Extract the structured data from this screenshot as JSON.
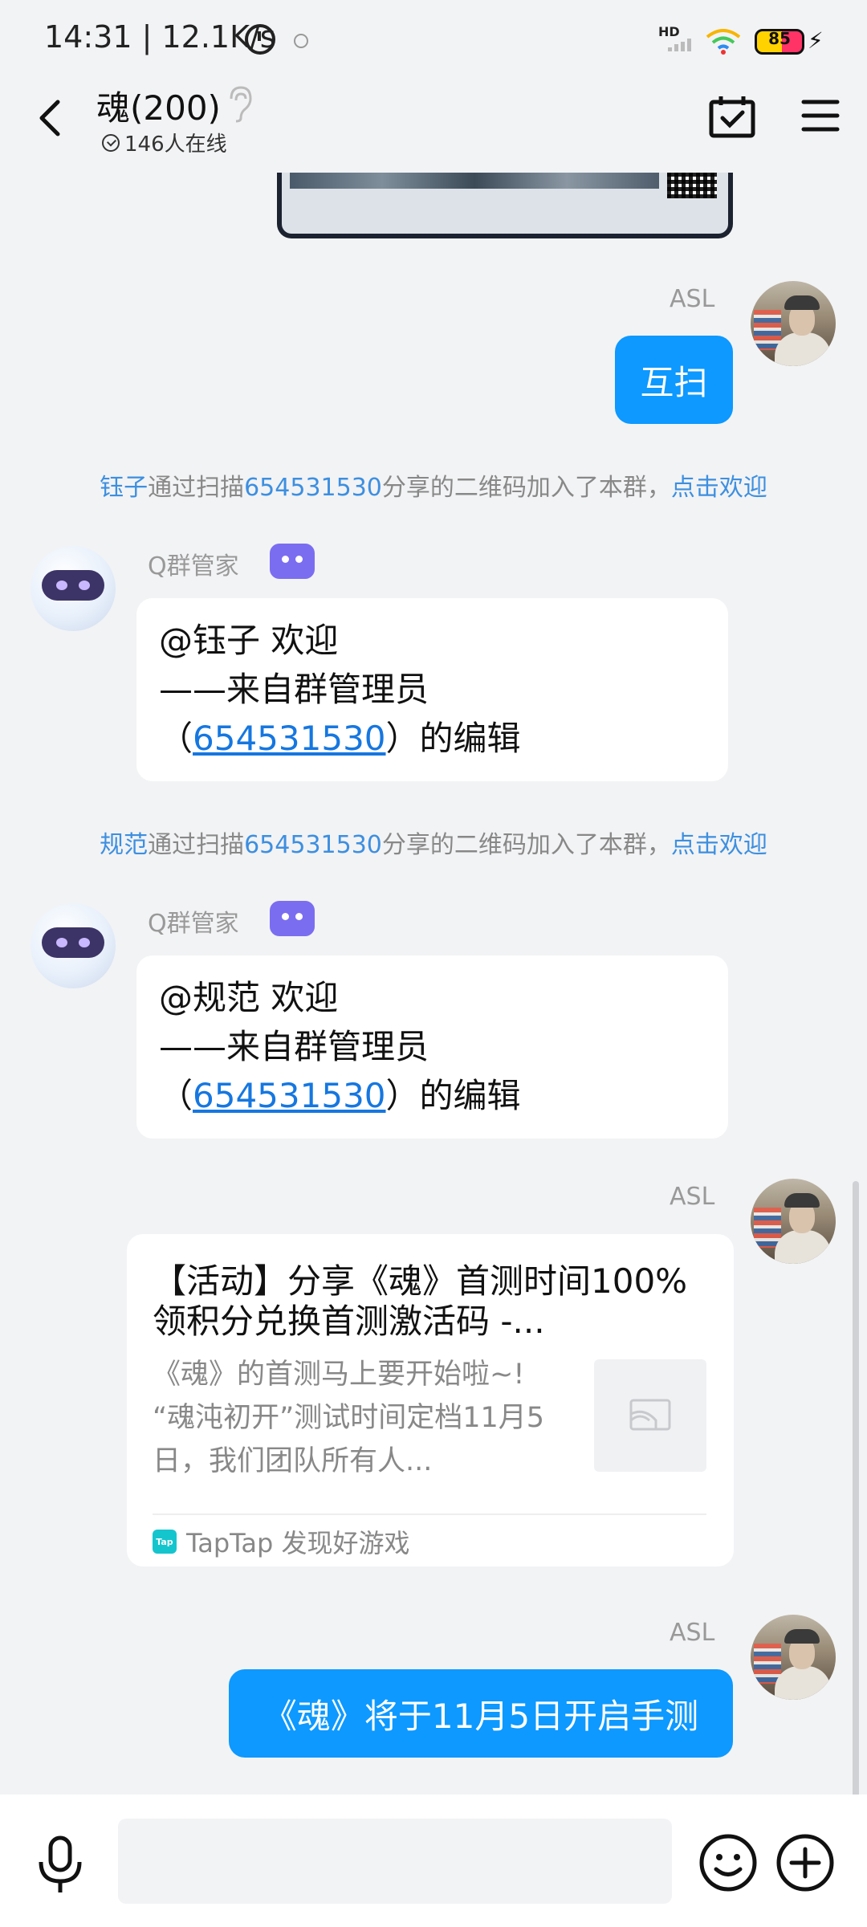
{
  "status_bar": {
    "time_speed": "14:31 | 12.1K/s",
    "network_badge": "HD",
    "battery": "85"
  },
  "header": {
    "title": "魂(200)",
    "online": "146人在线"
  },
  "messages": {
    "asl_name": "ASL",
    "msg1": "互扫",
    "sys1": {
      "name": "钰子",
      "text_a": "通过扫描",
      "id": "654531530",
      "text_b": "分享的二维码加入了本群，",
      "action": "点击欢迎"
    },
    "bot_name": "Q群管家",
    "bot1": {
      "line1": "@钰子 欢迎",
      "line2": "——来自群管理员",
      "paren_open": "（",
      "id": "654531530",
      "paren_close": "）的编辑"
    },
    "sys2": {
      "name": "规范",
      "text_a": "通过扫描",
      "id": "654531530",
      "text_b": "分享的二维码加入了本群，",
      "action": "点击欢迎"
    },
    "bot2": {
      "line1": "@规范 欢迎",
      "line2": "——来自群管理员",
      "paren_open": "（",
      "id": "654531530",
      "paren_close": "）的编辑"
    },
    "share": {
      "title": "【活动】分享《魂》首测时间100%领积分兑换首测激活码 -...",
      "desc": "《魂》的首测马上要开始啦~! “魂沌初开”测试时间定档11月5日，我们团队所有人...",
      "source": "TapTap 发现好游戏",
      "logo_text": "Tap"
    },
    "msg_last": "《魂》将于11月5日开启手测"
  },
  "input": {
    "placeholder": ""
  },
  "colors": {
    "accent": "#0d99ff",
    "link": "#1677e0",
    "background": "#f2f3f5"
  }
}
